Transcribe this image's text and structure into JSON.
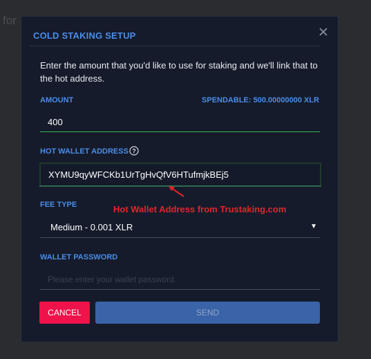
{
  "background": {
    "partial_text": "for"
  },
  "modal": {
    "title": "COLD STAKING SETUP",
    "description": "Enter the amount that you'd like to use for staking and we'll link that to the hot address.",
    "amount": {
      "label": "AMOUNT",
      "spendable": "SPENDABLE: 500.00000000 XLR",
      "value": "400"
    },
    "hot_wallet": {
      "label": "HOT WALLET ADDRESS",
      "value": "XYMU9qyWFCKb1UrTgHvQfV6HTufmjkBEj5",
      "annotation": "Hot Wallet Address from Trustaking.com"
    },
    "fee": {
      "label": "FEE TYPE",
      "selected": "Medium - 0.001 XLR"
    },
    "password": {
      "label": "WALLET PASSWORD",
      "placeholder": "Please enter your wallet password."
    },
    "buttons": {
      "cancel": "CANCEL",
      "send": "SEND"
    }
  },
  "colors": {
    "accent": "#4a8de8",
    "cancel": "#f0124a",
    "send": "#3a63a8",
    "annotation": "#e0262a",
    "valid_underline": "#3bb54a"
  }
}
